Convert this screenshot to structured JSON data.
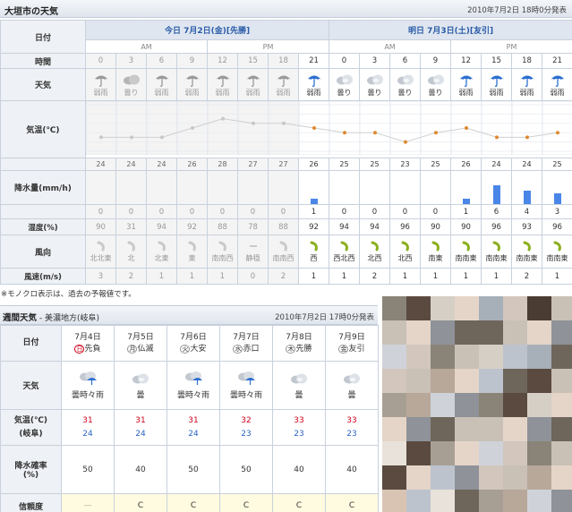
{
  "header": {
    "title": "大垣市の天気",
    "issued": "2010年7月2日 18時0分発表"
  },
  "hourly": {
    "labels": {
      "date": "日付",
      "time": "時間",
      "weather": "天気",
      "temp": "気温(℃)",
      "rain": "降水量(mm/h)",
      "humidity": "湿度(%)",
      "wind_dir": "風向",
      "wind_speed": "風速(m/s)"
    },
    "day1": {
      "label": "今日 7月2日(金)",
      "rokuyo": "[先勝]"
    },
    "day2": {
      "label": "明日 7月3日(土)",
      "rokuyo": "[友引]"
    },
    "ampm": [
      "AM",
      "PM",
      "AM",
      "PM"
    ],
    "hours": [
      "0",
      "3",
      "6",
      "9",
      "12",
      "15",
      "18",
      "21",
      "0",
      "3",
      "6",
      "9",
      "12",
      "15",
      "18",
      "21"
    ],
    "weather": [
      "弱雨",
      "曇り",
      "弱雨",
      "弱雨",
      "弱雨",
      "弱雨",
      "弱雨",
      "弱雨",
      "曇り",
      "曇り",
      "曇り",
      "曇り",
      "弱雨",
      "弱雨",
      "弱雨",
      "弱雨"
    ],
    "weather_icons": [
      "umbrella-icon",
      "cloud-icon",
      "umbrella-icon",
      "umbrella-icon",
      "umbrella-icon",
      "umbrella-icon",
      "umbrella-icon",
      "umbrella-icon",
      "cloud-icon",
      "cloud-icon",
      "cloud-icon",
      "cloud-icon",
      "umbrella-icon",
      "umbrella-icon",
      "umbrella-icon",
      "umbrella-icon"
    ],
    "temps": [
      "24",
      "24",
      "24",
      "26",
      "28",
      "27",
      "27",
      "26",
      "25",
      "25",
      "23",
      "25",
      "26",
      "24",
      "24",
      "25"
    ],
    "rain": [
      "0",
      "0",
      "0",
      "0",
      "0",
      "0",
      "0",
      "1",
      "0",
      "0",
      "0",
      "0",
      "1",
      "6",
      "4",
      "3"
    ],
    "humidity": [
      "90",
      "31",
      "94",
      "92",
      "88",
      "78",
      "88",
      "92",
      "94",
      "94",
      "96",
      "90",
      "90",
      "96",
      "93",
      "96"
    ],
    "wind_dir": [
      "北北東",
      "北",
      "北東",
      "東",
      "南南西",
      "静穏",
      "南南西",
      "西",
      "西北西",
      "北西",
      "北西",
      "南東",
      "南南東",
      "南南東",
      "南南東",
      "南南東"
    ],
    "wind_speed": [
      "3",
      "2",
      "1",
      "1",
      "1",
      "0",
      "2",
      "1",
      "1",
      "2",
      "1",
      "1",
      "1",
      "1",
      "2",
      "1"
    ]
  },
  "chart_data": {
    "type": "line",
    "title": "気温(℃)",
    "x": [
      "0",
      "3",
      "6",
      "9",
      "12",
      "15",
      "18",
      "21",
      "0",
      "3",
      "6",
      "9",
      "12",
      "15",
      "18",
      "21"
    ],
    "series": [
      {
        "name": "気温",
        "values": [
          24,
          24,
          24,
          26,
          28,
          27,
          27,
          26,
          25,
          25,
          23,
          25,
          26,
          24,
          24,
          25
        ]
      },
      {
        "name": "降水量",
        "values": [
          0,
          0,
          0,
          0,
          0,
          0,
          0,
          1,
          0,
          0,
          0,
          0,
          1,
          6,
          4,
          3
        ]
      }
    ],
    "yticks": [
      "31",
      "29",
      "27",
      "25",
      "23",
      "21"
    ],
    "ylim": [
      21,
      31
    ]
  },
  "note": "※モノクロ表示は、過去の予報値です。",
  "weekly": {
    "title": "週間天気",
    "region": " - 美濃地方(岐阜)",
    "issued": "2010年7月2日 17時0分発表",
    "labels": {
      "date": "日付",
      "weather": "天気",
      "temp": "気温(℃)",
      "temp_place": "(岐阜)",
      "rain": "降水確率",
      "rain_unit": "(%)",
      "reliability": "信頼度"
    },
    "days": [
      {
        "date": "7月4日",
        "dow": "日",
        "rokuyo": "先負",
        "weather": "曇時々雨",
        "hi": "31",
        "lo": "24",
        "rain": "50",
        "rel": "—"
      },
      {
        "date": "7月5日",
        "dow": "月",
        "rokuyo": "仏滅",
        "weather": "曇",
        "hi": "31",
        "lo": "24",
        "rain": "40",
        "rel": "C"
      },
      {
        "date": "7月6日",
        "dow": "火",
        "rokuyo": "大安",
        "weather": "曇時々雨",
        "hi": "31",
        "lo": "24",
        "rain": "50",
        "rel": "C"
      },
      {
        "date": "7月7日",
        "dow": "水",
        "rokuyo": "赤口",
        "weather": "曇時々雨",
        "hi": "32",
        "lo": "23",
        "rain": "50",
        "rel": "C"
      },
      {
        "date": "7月8日",
        "dow": "木",
        "rokuyo": "先勝",
        "weather": "曇",
        "hi": "33",
        "lo": "23",
        "rain": "40",
        "rel": "C"
      },
      {
        "date": "7月9日",
        "dow": "金",
        "rokuyo": "友引",
        "weather": "曇",
        "hi": "33",
        "lo": "23",
        "rain": "40",
        "rel": "C"
      }
    ]
  },
  "colors": {
    "accent": "#2b5ca8",
    "high": "#d0021b",
    "low": "#2a64c5",
    "temp_line": "#e0892f",
    "rain_bar": "#4a86e8"
  }
}
